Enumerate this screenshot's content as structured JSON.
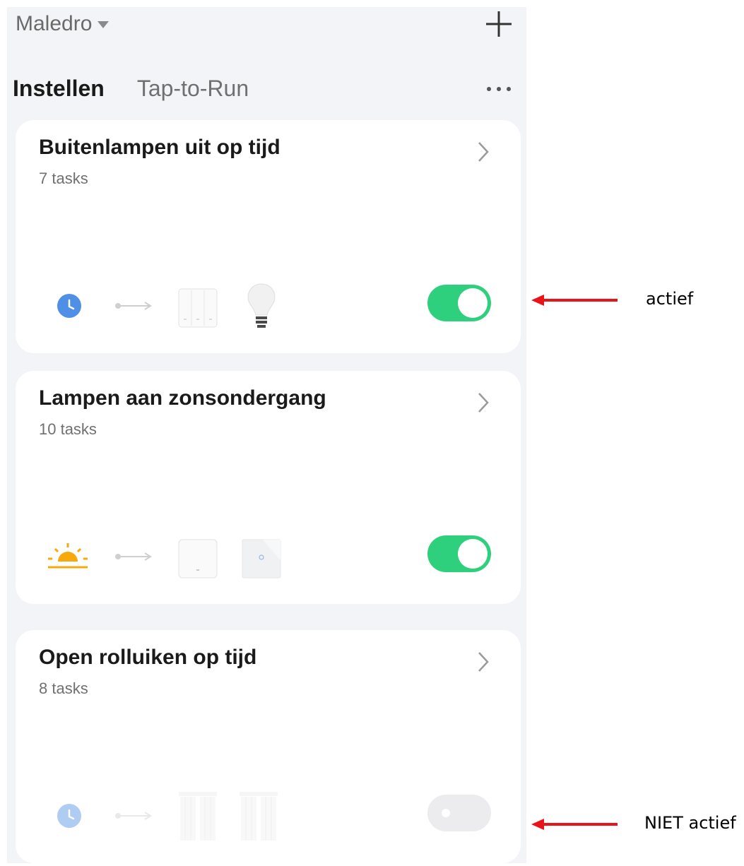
{
  "header": {
    "home_name": "Maledro",
    "tabs": [
      {
        "label": "Instellen",
        "active": true
      },
      {
        "label": "Tap-to-Run",
        "active": false
      }
    ]
  },
  "scenes": [
    {
      "title": "Buitenlampen uit op tijd",
      "tasks": "7 tasks",
      "enabled": true,
      "condition_icon": "clock-icon",
      "action_icons": [
        "triple-switch-icon",
        "light-bulb-icon"
      ]
    },
    {
      "title": "Lampen aan zonsondergang",
      "tasks": "10 tasks",
      "enabled": true,
      "condition_icon": "sunset-icon",
      "action_icons": [
        "single-switch-icon",
        "glass-touch-switch-icon"
      ]
    },
    {
      "title": "Open rolluiken op tijd",
      "tasks": "8 tasks",
      "enabled": false,
      "condition_icon": "clock-icon",
      "action_icons": [
        "curtain-icon",
        "curtain-icon"
      ]
    }
  ],
  "annotations": {
    "active_label": "actief",
    "inactive_label": "NIET actief"
  },
  "colors": {
    "toggle_on": "#2fd07d",
    "toggle_off": "#ececee",
    "clock_blue": "#4f8fe6",
    "sun_orange": "#f7a80a",
    "annotation_arrow": "#e8141a",
    "background": "#f3f4f8"
  }
}
